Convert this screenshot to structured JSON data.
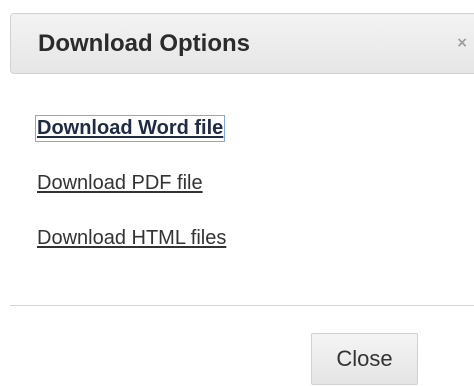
{
  "dialog": {
    "title": "Download Options",
    "close_icon": "×"
  },
  "links": {
    "word": "Download Word file",
    "pdf": "Download PDF file",
    "html": "Download HTML files"
  },
  "footer": {
    "close_label": "Close"
  }
}
